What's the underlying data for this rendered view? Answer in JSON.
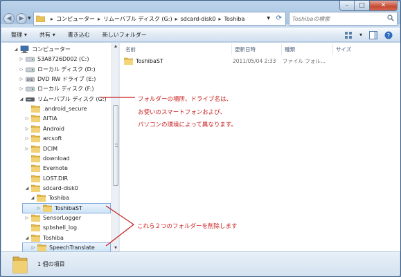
{
  "window": {
    "min_glyph": "–",
    "max_glyph": "□",
    "close_glyph": "✕"
  },
  "address": {
    "crumbs": [
      "コンピューター",
      "リムーバブル ディスク (G:)",
      "sdcard-disk0",
      "Toshiba"
    ],
    "separator": "▸"
  },
  "search": {
    "placeholder": "Toshibaの検索"
  },
  "toolbar": {
    "organize": "整理",
    "share": "共有",
    "burn": "書き込む",
    "new_folder": "新しいフォルダー"
  },
  "nav_tree": [
    {
      "label": "コンピューター",
      "icon": "computer-icon",
      "expander": "◢",
      "indent": 0
    },
    {
      "label": "S3A8726D002 (C:)",
      "icon": "drive-icon",
      "expander": "▷",
      "indent": 1
    },
    {
      "label": "ローカル ディスク (D:)",
      "icon": "drive-icon",
      "expander": "▷",
      "indent": 1
    },
    {
      "label": "DVD RW ドライブ (E:)",
      "icon": "dvd-drive-icon",
      "expander": "▷",
      "indent": 1
    },
    {
      "label": "ローカル ディスク (F:)",
      "icon": "drive-icon",
      "expander": "▷",
      "indent": 1
    },
    {
      "label": "リムーバブル ディスク (G:)",
      "icon": "removable-drive-icon",
      "expander": "◢",
      "indent": 1
    },
    {
      "label": ".android_secure",
      "icon": "folder-icon",
      "expander": "",
      "indent": 2
    },
    {
      "label": "AITIA",
      "icon": "folder-icon",
      "expander": "▷",
      "indent": 2
    },
    {
      "label": "Android",
      "icon": "folder-icon",
      "expander": "▷",
      "indent": 2
    },
    {
      "label": "arcsoft",
      "icon": "folder-icon",
      "expander": "▷",
      "indent": 2
    },
    {
      "label": "DCIM",
      "icon": "folder-icon",
      "expander": "▷",
      "indent": 2
    },
    {
      "label": "download",
      "icon": "folder-icon",
      "expander": "",
      "indent": 2
    },
    {
      "label": "Evernote",
      "icon": "folder-icon",
      "expander": "",
      "indent": 2
    },
    {
      "label": "LOST.DIR",
      "icon": "folder-icon",
      "expander": "",
      "indent": 2
    },
    {
      "label": "sdcard-disk0",
      "icon": "folder-icon",
      "expander": "◢",
      "indent": 2
    },
    {
      "label": "Toshiba",
      "icon": "folder-icon",
      "expander": "◢",
      "indent": 3
    },
    {
      "label": "ToshibaST",
      "icon": "folder-icon",
      "expander": "▷",
      "indent": 4,
      "selected": true
    },
    {
      "label": "SensorLogger",
      "icon": "folder-icon",
      "expander": "▷",
      "indent": 2
    },
    {
      "label": "spbshell_log",
      "icon": "folder-icon",
      "expander": "",
      "indent": 2
    },
    {
      "label": "Toshiba",
      "icon": "folder-icon",
      "expander": "◢",
      "indent": 2
    },
    {
      "label": "SpeechTranslate",
      "icon": "folder-icon",
      "expander": "▷",
      "indent": 3,
      "selected": true
    }
  ],
  "columns": {
    "name": "名前",
    "date": "更新日時",
    "type": "種類",
    "size": "サイズ"
  },
  "files": [
    {
      "name": "ToshibaST",
      "date": "2011/05/04 2:33",
      "type": "ファイル フォル..."
    }
  ],
  "annotations": {
    "note1_line1": "フォルダーの場所、ドライブ名は、",
    "note1_line2": "お使いのスマートフォンおよび、",
    "note1_line3": "パソコンの環境によって異なります。",
    "note2": "これら２つのフォルダーを削除します",
    "color": "#c81e1e"
  },
  "status": {
    "item_count": "1 個の項目"
  },
  "scrollbar": {
    "up": "▲",
    "down": "▼"
  }
}
